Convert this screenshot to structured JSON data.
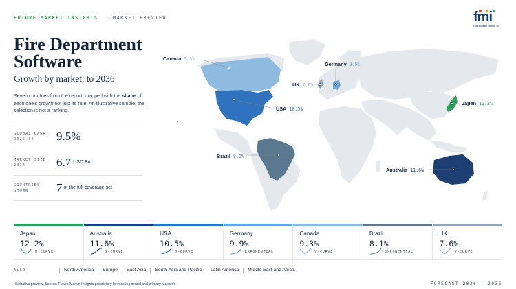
{
  "header": {
    "brand": "FUTURE MARKET INSIGHTS",
    "separator": "·",
    "section": "MARKET PREVIEW",
    "logo_text": "fmi",
    "logo_subtext": "Future Market Insights, Inc."
  },
  "title": "Fire Department Software",
  "subtitle": "Growth by market, to 2036",
  "description": {
    "before": "Seven countries from the report, mapped with the ",
    "bold": "shape",
    "after": " of each one's growth not just its rate. An illustrative sample; the selection is not a ranking."
  },
  "stats": [
    {
      "label_line1": "GLOBAL CAGR",
      "label_line2": "2026-36",
      "value": "9.5%",
      "unit": ""
    },
    {
      "label_line1": "MARKET SIZE",
      "label_line2": "2036",
      "value": "6.7",
      "unit": "USD Bn"
    },
    {
      "label_line1": "COUNTRIES",
      "label_line2": "SHOWN",
      "value": "7",
      "unit": "of the full coverage set"
    }
  ],
  "map": {
    "labels": [
      {
        "name": "Canada",
        "value": "9.3%",
        "color": "#8fbbe0"
      },
      {
        "name": "Germany",
        "value": "9.9%",
        "color": "#6fa4d8"
      },
      {
        "name": "UK",
        "value": "7.6%",
        "color": "#8fa5bb"
      },
      {
        "name": "USA",
        "value": "10.5%",
        "color": "#2f73bf"
      },
      {
        "name": "Japan",
        "value": "12.2%",
        "color": "#2f9e57"
      },
      {
        "name": "Brazil",
        "value": "8.1%",
        "color": "#5b7891"
      },
      {
        "name": "Australia",
        "value": "11.6%",
        "color": "#1d3f72"
      }
    ]
  },
  "cards": [
    {
      "name": "Japan",
      "value": "12.2%",
      "shape": "U-CURVE",
      "color": "#2f9e57",
      "icon": "u-curve-icon"
    },
    {
      "name": "Australia",
      "value": "11.6%",
      "shape": "S-CURVE",
      "color": "#1d3f72",
      "icon": "s-curve-icon"
    },
    {
      "name": "USA",
      "value": "10.5%",
      "shape": "J-CURVE",
      "color": "#2f73bf",
      "icon": "j-curve-icon"
    },
    {
      "name": "Germany",
      "value": "9.9%",
      "shape": "EXPONENTIAL",
      "color": "#6fa4d8",
      "icon": "exponential-curve-icon"
    },
    {
      "name": "Canada",
      "value": "9.3%",
      "shape": "V-CURVE",
      "color": "#8fbbe0",
      "icon": "v-curve-icon"
    },
    {
      "name": "Brazil",
      "value": "8.1%",
      "shape": "EXPONENTIAL",
      "color": "#5b7891",
      "icon": "exponential-curve-icon"
    },
    {
      "name": "UK",
      "value": "7.6%",
      "shape": "V-CURVE",
      "color": "#8fa5bb",
      "icon": "v-curve-icon"
    }
  ],
  "also": {
    "label": "ALSO",
    "regions": [
      "North America",
      "Europe",
      "East Asia",
      "South Asia and Pacific",
      "Latin America",
      "Middle East and Africa."
    ]
  },
  "footer": {
    "source": "Illustrative preview. Source: Future Market Insights proprietary forecasting model and primary research.",
    "forecast": "FORECAST 2026 – 2036"
  }
}
